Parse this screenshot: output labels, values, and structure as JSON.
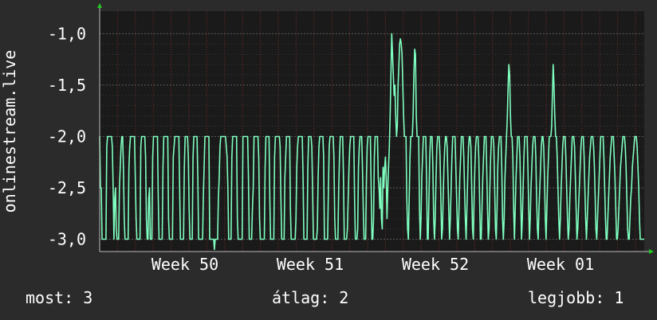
{
  "colors": {
    "background": "#2b2b2b",
    "plot_background": "#1a1a1a",
    "grid": "#5a5a5a",
    "grid_minor": "#7a2a2a",
    "line": "#7fffc0",
    "axis_arrow": "#22cc22",
    "text": "#ffffff"
  },
  "footer": {
    "now": "most: 3",
    "avg": "átlag: 2",
    "best": "legjobb: 1"
  },
  "chart_data": {
    "type": "line",
    "ylabel": "onlinestream.live",
    "xlabel": "",
    "title": "",
    "ylim": [
      -3.12,
      -0.78
    ],
    "yticks": [
      -1.0,
      -1.5,
      -2.0,
      -2.5,
      -3.0
    ],
    "ytick_labels": [
      "-1,0",
      "-1,5",
      "-2,0",
      "-2,5",
      "-3,0"
    ],
    "xlim": [
      0,
      683
    ],
    "xtick_positions": [
      82,
      239,
      396,
      553
    ],
    "xtick_labels": [
      "Week 50",
      "Week 51",
      "Week 52",
      "Week 01"
    ],
    "grid": true,
    "series": [
      {
        "values": [
          -2.0,
          -2.5,
          -2.5,
          -3.0,
          -3.0,
          -3.0,
          -3.0,
          -3.0,
          -3.0,
          -2.1,
          -2.0,
          -2.0,
          -2.0,
          -2.0,
          -2.0,
          -2.0,
          -2.1,
          -2.5,
          -3.0,
          -2.6,
          -2.5,
          -2.9,
          -3.0,
          -3.0,
          -3.0,
          -2.5,
          -2.3,
          -2.1,
          -2.0,
          -2.0,
          -2.3,
          -2.8,
          -3.0,
          -3.0,
          -3.0,
          -3.0,
          -3.0,
          -2.3,
          -2.1,
          -2.0,
          -2.0,
          -2.0,
          -2.0,
          -2.0,
          -2.0,
          -2.4,
          -2.8,
          -3.0,
          -3.0,
          -3.0,
          -3.0,
          -3.0,
          -2.1,
          -2.0,
          -2.0,
          -2.0,
          -2.0,
          -2.0,
          -2.2,
          -2.8,
          -3.0,
          -3.0,
          -2.6,
          -2.5,
          -3.0,
          -3.0,
          -3.0,
          -2.2,
          -2.0,
          -2.0,
          -2.0,
          -2.0,
          -2.0,
          -2.0,
          -2.6,
          -3.0,
          -3.0,
          -3.0,
          -3.0,
          -3.0,
          -2.3,
          -2.0,
          -2.0,
          -2.0,
          -2.0,
          -2.0,
          -2.0,
          -2.8,
          -3.0,
          -3.0,
          -3.0,
          -3.0,
          -3.0,
          -2.2,
          -2.1,
          -2.0,
          -2.0,
          -2.0,
          -2.0,
          -2.0,
          -2.0,
          -2.5,
          -3.0,
          -3.0,
          -3.0,
          -3.0,
          -3.0,
          -2.3,
          -2.0,
          -2.0,
          -2.0,
          -2.0,
          -2.2,
          -2.7,
          -3.0,
          -3.0,
          -3.0,
          -3.0,
          -2.2,
          -2.0,
          -2.0,
          -2.0,
          -2.0,
          -2.0,
          -2.4,
          -3.0,
          -3.0,
          -3.0,
          -3.0,
          -3.0,
          -3.0,
          -2.6,
          -2.3,
          -2.0,
          -2.0,
          -2.0,
          -2.0,
          -2.0,
          -2.0,
          -3.0,
          -3.0,
          -3.0,
          -3.0,
          -3.0,
          -3.0,
          -3.1,
          -3.0,
          -3.0,
          -3.0,
          -3.0,
          -2.6,
          -2.4,
          -2.1,
          -2.0,
          -2.0,
          -2.0,
          -2.0,
          -2.0,
          -2.0,
          -2.0,
          -2.1,
          -2.2,
          -2.5,
          -3.0,
          -3.0,
          -3.0,
          -3.0,
          -2.2,
          -2.0,
          -2.0,
          -2.0,
          -2.0,
          -2.0,
          -2.0,
          -2.8,
          -3.0,
          -3.0,
          -3.0,
          -3.0,
          -3.0,
          -3.0,
          -2.0,
          -2.0,
          -2.0,
          -2.0,
          -2.0,
          -2.0,
          -2.0,
          -2.4,
          -3.0,
          -3.0,
          -3.0,
          -3.0,
          -2.7,
          -2.5,
          -2.0,
          -2.0,
          -2.0,
          -2.0,
          -2.0,
          -2.0,
          -2.2,
          -2.8,
          -3.0,
          -3.0,
          -3.0,
          -3.0,
          -3.0,
          -3.0,
          -2.3,
          -2.0,
          -2.0,
          -2.0,
          -2.0,
          -2.0,
          -2.6,
          -3.0,
          -3.0,
          -3.0,
          -3.0,
          -3.0,
          -2.2,
          -2.0,
          -2.0,
          -2.0,
          -2.0,
          -2.0,
          -2.0,
          -2.1,
          -2.6,
          -3.0,
          -3.0,
          -3.0,
          -3.0,
          -2.4,
          -2.2,
          -2.0,
          -2.0,
          -2.0,
          -2.0,
          -2.0,
          -2.7,
          -3.0,
          -3.0,
          -3.0,
          -3.0,
          -3.0,
          -3.0,
          -2.8,
          -2.3,
          -2.1,
          -2.0,
          -2.0,
          -2.0,
          -2.0,
          -2.0,
          -2.0,
          -2.4,
          -3.0,
          -3.0,
          -3.0,
          -3.0,
          -3.0,
          -2.3,
          -2.0,
          -2.0,
          -2.0,
          -2.0,
          -2.1,
          -2.5,
          -3.0,
          -3.0,
          -3.0,
          -3.0,
          -3.0,
          -2.9,
          -2.4,
          -2.1,
          -2.0,
          -2.0,
          -2.0,
          -2.0,
          -2.0,
          -2.2,
          -3.0,
          -3.0,
          -3.0,
          -3.0,
          -3.0,
          -2.5,
          -2.1,
          -2.0,
          -2.0,
          -2.0,
          -2.0,
          -2.0,
          -2.2,
          -2.8,
          -3.0,
          -3.0,
          -3.0,
          -3.0,
          -2.5,
          -2.2,
          -2.0,
          -2.0,
          -2.0,
          -2.0,
          -2.4,
          -3.0,
          -3.0,
          -3.0,
          -3.0,
          -2.9,
          -2.6,
          -2.3,
          -2.1,
          -2.0,
          -2.0,
          -2.0,
          -2.0,
          -2.0,
          -2.6,
          -3.0,
          -3.0,
          -3.0,
          -2.9,
          -2.3,
          -2.1,
          -2.0,
          -2.0,
          -2.0,
          -2.3,
          -2.7,
          -3.0,
          -3.0,
          -3.0,
          -2.4,
          -2.1,
          -2.0,
          -2.0,
          -2.0,
          -2.0,
          -2.5,
          -3.0,
          -3.0,
          -2.8,
          -2.2,
          -2.0,
          -2.0,
          -2.0,
          -2.0,
          -2.4,
          -2.5,
          -2.7,
          -2.4,
          -2.8,
          -2.9,
          -2.3,
          -2.5,
          -2.3,
          -2.2,
          -2.4,
          -2.8,
          -2.5,
          -2.3,
          -2.1,
          -1.8,
          -1.4,
          -1.0,
          -1.2,
          -1.4,
          -1.6,
          -1.5,
          -1.8,
          -2.0,
          -1.9,
          -1.5,
          -1.3,
          -1.1,
          -1.05,
          -1.1,
          -1.2,
          -1.5,
          -1.8,
          -2.0,
          -2.0,
          -2.0,
          -2.6,
          -2.9,
          -3.0,
          -2.6,
          -2.2,
          -2.0,
          -2.0,
          -2.0,
          -1.8,
          -1.4,
          -1.15,
          -1.2,
          -1.8,
          -2.0,
          -2.0,
          -2.0,
          -2.7,
          -3.0,
          -2.8,
          -2.4,
          -2.2,
          -2.0,
          -2.0,
          -2.0,
          -2.0,
          -2.4,
          -3.0,
          -3.0,
          -2.6,
          -2.2,
          -2.0,
          -2.0,
          -2.0,
          -2.3,
          -2.8,
          -3.0,
          -2.8,
          -2.4,
          -2.1,
          -2.0,
          -2.0,
          -2.0,
          -2.2,
          -2.6,
          -3.0,
          -2.9,
          -2.6,
          -2.3,
          -2.1,
          -2.0,
          -2.0,
          -2.1,
          -2.4,
          -2.7,
          -3.0,
          -2.8,
          -2.5,
          -2.2,
          -2.0,
          -2.0,
          -2.0,
          -2.0,
          -2.3,
          -2.6,
          -2.9,
          -3.0,
          -2.7,
          -2.4,
          -2.2,
          -2.0,
          -2.0,
          -2.0,
          -2.2,
          -2.5,
          -2.8,
          -3.0,
          -2.7,
          -2.4,
          -2.1,
          -2.0,
          -2.0,
          -2.1,
          -2.5,
          -2.9,
          -3.0,
          -2.6,
          -2.3,
          -2.1,
          -2.0,
          -2.0,
          -2.0,
          -2.2,
          -2.6,
          -3.0,
          -3.0,
          -2.7,
          -2.4,
          -2.2,
          -2.0,
          -2.0,
          -2.0,
          -2.3,
          -2.7,
          -3.0,
          -2.9,
          -2.5,
          -2.2,
          -2.0,
          -2.0,
          -2.0,
          -2.1,
          -2.5,
          -2.9,
          -3.0,
          -2.7,
          -2.3,
          -2.1,
          -2.0,
          -2.0,
          -2.0,
          -2.3,
          -2.8,
          -3.0,
          -2.8,
          -2.4,
          -2.2,
          -2.0,
          -1.8,
          -1.5,
          -1.3,
          -1.4,
          -1.8,
          -2.0,
          -2.0,
          -2.2,
          -2.7,
          -3.0,
          -2.7,
          -2.4,
          -2.2,
          -2.0,
          -2.0,
          -2.0,
          -2.2,
          -2.6,
          -3.0,
          -2.8,
          -2.5,
          -2.2,
          -2.0,
          -2.0,
          -2.0,
          -2.0,
          -2.3,
          -2.7,
          -3.0,
          -2.8,
          -2.5,
          -2.3,
          -2.1,
          -2.0,
          -2.0,
          -2.0,
          -2.2,
          -2.6,
          -2.9,
          -3.0,
          -2.7,
          -2.5,
          -2.3,
          -2.1,
          -2.0,
          -2.0,
          -2.1,
          -2.4,
          -2.8,
          -3.0,
          -2.7,
          -2.4,
          -2.2,
          -2.0,
          -2.0,
          -2.0,
          -1.9,
          -1.6,
          -1.3,
          -1.5,
          -1.8,
          -2.0,
          -2.0,
          -2.2,
          -2.5,
          -2.8,
          -3.0,
          -2.8,
          -2.5,
          -2.3,
          -2.1,
          -2.0,
          -2.0,
          -2.0,
          -2.2,
          -2.5,
          -2.8,
          -3.0,
          -2.9,
          -2.6,
          -2.4,
          -2.2,
          -2.0,
          -2.0,
          -2.0,
          -2.1,
          -2.4,
          -2.7,
          -3.0,
          -2.9,
          -2.7,
          -2.5,
          -2.3,
          -2.1,
          -2.0,
          -2.0,
          -2.0,
          -2.2,
          -2.5,
          -2.8,
          -3.0,
          -2.8,
          -2.6,
          -2.4,
          -2.2,
          -2.1,
          -2.0,
          -2.0,
          -2.0,
          -2.1,
          -2.3,
          -2.6,
          -2.9,
          -3.0,
          -2.8,
          -2.6,
          -2.4,
          -2.2,
          -2.0,
          -2.0,
          -2.0,
          -2.0,
          -2.2,
          -2.5,
          -2.8,
          -3.0,
          -3.0,
          -2.8,
          -2.6,
          -2.4,
          -2.2,
          -2.1,
          -2.0,
          -2.0,
          -2.0,
          -2.2,
          -2.4,
          -2.7,
          -3.0,
          -3.0,
          -2.9,
          -2.7,
          -2.5,
          -2.3,
          -2.2,
          -2.1,
          -2.0,
          -2.0,
          -2.0,
          -2.1,
          -2.3,
          -2.6,
          -2.9,
          -3.0,
          -3.0,
          -2.8,
          -2.6,
          -2.5,
          -2.3,
          -2.2,
          -2.1,
          -2.0,
          -2.0,
          -2.0,
          -2.1,
          -2.3,
          -2.5,
          -2.8,
          -3.0,
          -3.0,
          -3.0,
          -3.0,
          -3.0,
          -3.0
        ]
      }
    ]
  }
}
